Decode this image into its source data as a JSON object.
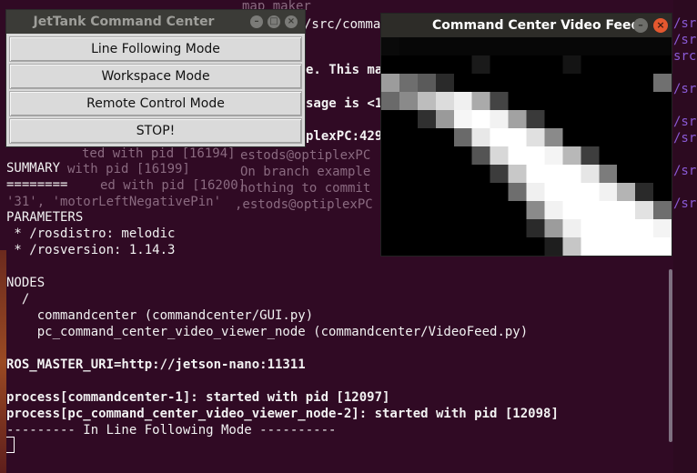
{
  "command_center": {
    "title": "JetTank Command Center",
    "buttons": [
      {
        "label": "Line Following Mode"
      },
      {
        "label": "Workspace Mode"
      },
      {
        "label": "Remote Control Mode"
      },
      {
        "label": "STOP!"
      }
    ]
  },
  "video_feed": {
    "title": "Command Center Video Feed"
  },
  "terminal": {
    "peek_top": [
      "map_maker",
      "/src/command"
    ],
    "peek_right": [
      "e. This ma",
      "sage is <1",
      "plexPC:429"
    ],
    "faint_lines": [
      "ted with pid [16194]",
      "with pid [16199]",
      "ed with pid [16200]",
      "'31', 'motorLeftNegativePin'",
      "estods@optiplexPC",
      "On branch example",
      "nothing to commit",
      ",estods@optiplexPC"
    ],
    "lines": [
      "SUMMARY",
      "========",
      "",
      "PARAMETERS",
      " * /rosdistro: melodic",
      " * /rosversion: 1.14.3",
      "",
      "NODES",
      "  /",
      "    commandcenter (commandcenter/GUI.py)",
      "    pc_command_center_video_viewer_node (commandcenter/VideoFeed.py)",
      "",
      "ROS_MASTER_URI=http://jetson-nano:11311",
      "",
      "process[commandcenter-1]: started with pid [12097]",
      "process[pc_command_center_video_viewer_node-2]: started with pid [12098]",
      "--------- In Line Following Mode ----------"
    ]
  },
  "background_right": [
    "/sro",
    "/sro",
    "src",
    "/sro",
    "/sro",
    "/sro",
    "/sro",
    "/sro"
  ]
}
